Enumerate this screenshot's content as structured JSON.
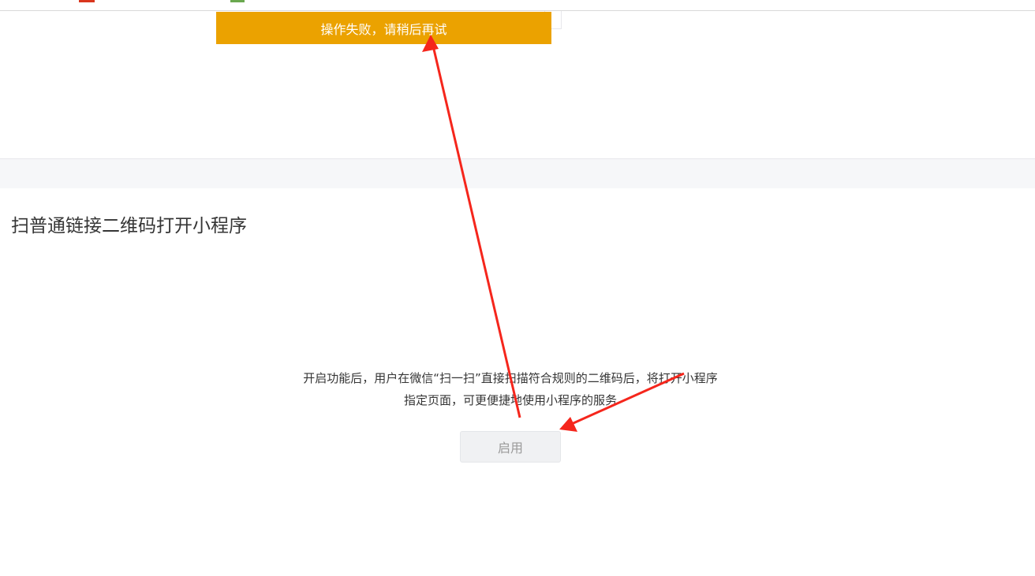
{
  "toast": {
    "message": "操作失败，请稍后再试"
  },
  "section": {
    "title": "扫普通链接二维码打开小程序"
  },
  "description": {
    "line1": "开启功能后，用户在微信“扫一扫”直接扫描符合规则的二维码后，将打开小程序",
    "line2": "指定页面，可更便捷地使用小程序的服务"
  },
  "enable_button": {
    "label": "启用",
    "state": "disabled"
  },
  "colors": {
    "toast_bg": "#eba200",
    "annotation_arrow": "#f5261c",
    "button_disabled_bg": "#f0f1f3",
    "button_disabled_text": "#9a9a9a"
  }
}
